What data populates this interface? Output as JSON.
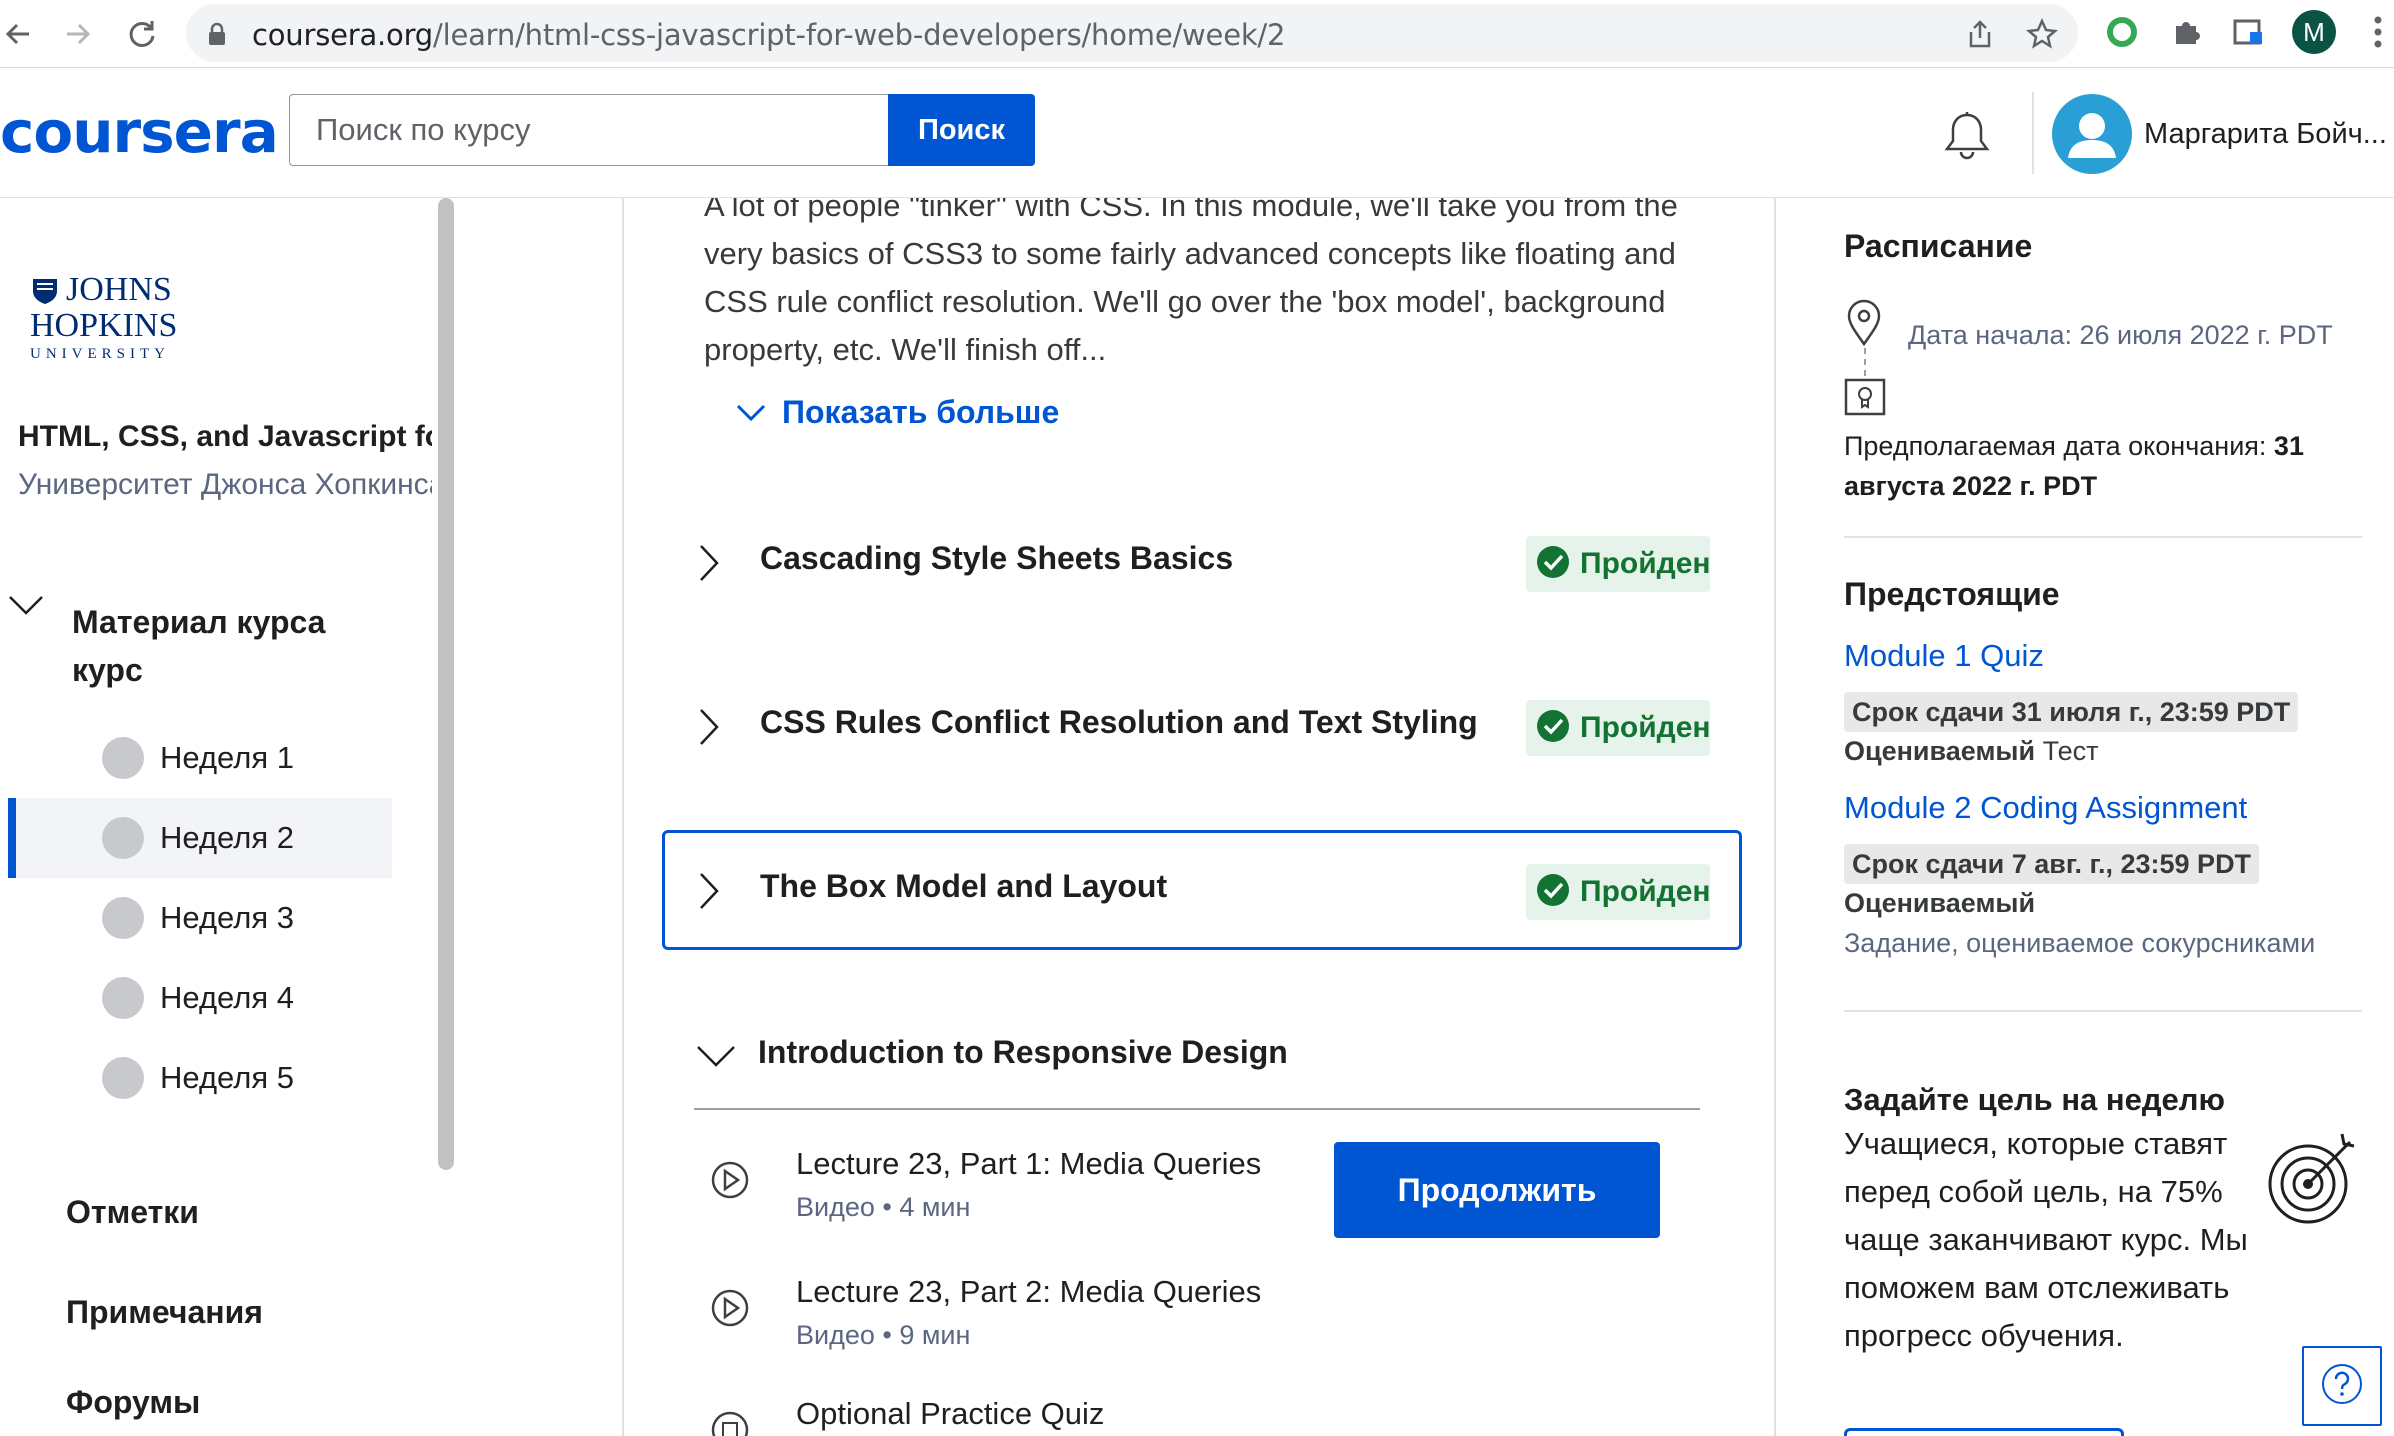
{
  "browser": {
    "url_domain": "coursera.org",
    "url_path": "/learn/html-css-javascript-for-web-developers/home/week/2",
    "profile_initial": "M",
    "accent_color": "#0056d2"
  },
  "header": {
    "logo": "coursera",
    "search_placeholder": "Поиск по курсу",
    "search_button": "Поиск",
    "user_name": "Маргарита Бойч..."
  },
  "sidebar": {
    "institution_line1": "JOHNS",
    "institution_line2": "HOPKINS",
    "institution_line3": "UNIVERSITY",
    "course_title": "HTML, CSS, and Javascript for Web Developers",
    "course_university": "Университет Джонса Хопкинса",
    "material_label": "Материал курса курс",
    "weeks": [
      {
        "label": "Неделя 1",
        "active": false
      },
      {
        "label": "Неделя 2",
        "active": true
      },
      {
        "label": "Неделя 3",
        "active": false
      },
      {
        "label": "Неделя 4",
        "active": false
      },
      {
        "label": "Неделя 5",
        "active": false
      }
    ],
    "links": [
      "Отметки",
      "Примечания",
      "Форумы"
    ]
  },
  "main": {
    "description": "A lot of people \"tinker\" with CSS. In this module, we'll take you from the very basics of CSS3 to some fairly advanced concepts like floating and CSS rule conflict resolution. We'll go over the 'box model', background property, etc. We'll finish off...",
    "show_more": "Показать больше",
    "lessons": [
      {
        "title": "Cascading Style Sheets Basics",
        "status": "Пройден"
      },
      {
        "title": "CSS Rules Conflict Resolution and Text Styling",
        "status": "Пройден"
      },
      {
        "title": "The Box Model and Layout",
        "status": "Пройден"
      }
    ],
    "open_lesson": {
      "title": "Introduction to Responsive Design",
      "items": [
        {
          "title": "Lecture 23, Part 1: Media Queries",
          "meta": "Видео • 4 мин"
        },
        {
          "title": "Lecture 23, Part 2: Media Queries",
          "meta": "Видео • 9 мин"
        },
        {
          "title": "Optional Practice Quiz",
          "meta": ""
        }
      ],
      "continue_button": "Продолжить"
    }
  },
  "right": {
    "schedule_title": "Расписание",
    "start_date": "Дата начала: 26 июля 2022 г. PDT",
    "end_date_label": "Предполагаемая дата окончания: ",
    "end_date_value": "31 августа 2022 г. PDT",
    "upcoming_title": "Предстоящие",
    "upcoming": [
      {
        "title": "Module 1 Quiz",
        "due": "Срок сдачи 31 июля г., 23:59 PDT",
        "graded": "Оцениваемый",
        "type": "Тест"
      },
      {
        "title": "Module 2 Coding Assignment",
        "due": "Срок сдачи 7 авг. г., 23:59 PDT",
        "graded": "Оцениваемый",
        "type": "Задание, оцениваемое сокурсниками"
      }
    ],
    "goal_title": "Задайте цель на неделю",
    "goal_text": "Учащиеся, которые ставят перед собой цель, на 75% чаще заканчивают курс. Мы поможем вам отслеживать прогресс обучения."
  }
}
